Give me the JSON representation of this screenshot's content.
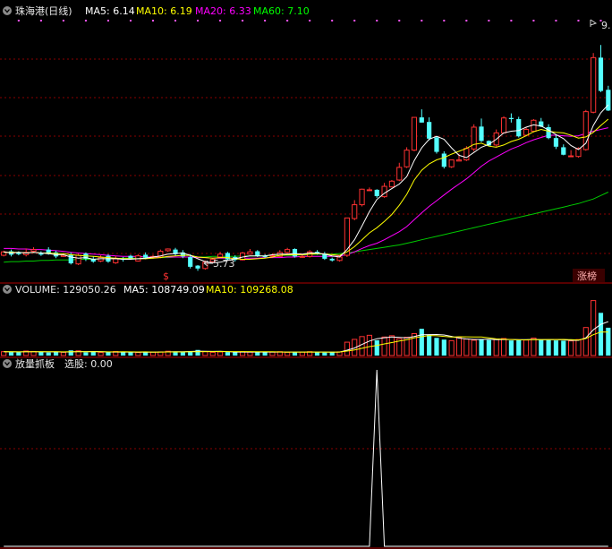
{
  "header": {
    "stock_name": "珠海港(日线)",
    "ma5": "MA5: 6.14",
    "ma10": "MA10: 6.19",
    "ma20": "MA20: 6.33",
    "ma60": "MA60: 7.10"
  },
  "volume_header": {
    "volume": "VOLUME: 129050.26",
    "ma5": "MA5: 108749.09",
    "ma10": "MA10: 109268.08"
  },
  "indicator_header": {
    "name": "放量抓板",
    "value": "选股: 0.00"
  },
  "annotations": {
    "low_label": "5.73",
    "high_label": "9.",
    "marker": "$",
    "badge": "涨榜"
  },
  "colors": {
    "up": "#ff3232",
    "down": "#54ffff",
    "ma5": "#ffffff",
    "ma10": "#ffff00",
    "ma20": "#ff00ff",
    "ma60": "#00cc00",
    "grid": "#8a0000"
  },
  "chart_data": [
    {
      "type": "candlestick",
      "series": [
        {
          "name": "K",
          "open": [
            6.0,
            6.07,
            6.04,
            6.01,
            6.07,
            6.03,
            6.1,
            6.05,
            5.98,
            6.01,
            5.85,
            6.03,
            5.93,
            5.9,
            5.99,
            5.87,
            5.94,
            5.99,
            5.9,
            6.01,
            5.96,
            5.97,
            6.08,
            6.1,
            6.05,
            5.97,
            5.82,
            5.77,
            5.89,
            5.97,
            6.04,
            5.97,
            5.92,
            6.02,
            6.07,
            5.99,
            6.0,
            5.98,
            6.05,
            6.11,
            5.98,
            5.98,
            6.06,
            6.03,
            5.94,
            5.91,
            6.0,
            6.64,
            6.88,
            7.14,
            7.14,
            7.02,
            7.19,
            7.31,
            7.54,
            7.83,
            8.4,
            8.32,
            8.05,
            7.77,
            7.54,
            7.64,
            7.66,
            7.85,
            8.24,
            7.99,
            7.92,
            8.13,
            8.39,
            8.37,
            8.09,
            8.16,
            8.33,
            8.23,
            8.04,
            7.88,
            7.72,
            7.72,
            7.84,
            8.49,
            9.44,
            8.88
          ],
          "close": [
            6.06,
            6.01,
            6.02,
            6.05,
            6.1,
            6.01,
            6.02,
            5.98,
            6.0,
            5.86,
            6.0,
            5.94,
            5.89,
            5.96,
            5.89,
            5.94,
            5.93,
            5.94,
            5.99,
            5.96,
            5.98,
            6.07,
            6.11,
            6.02,
            5.98,
            5.8,
            5.77,
            5.88,
            5.93,
            6.02,
            5.93,
            5.92,
            6.04,
            6.06,
            5.99,
            5.97,
            6.0,
            6.05,
            6.1,
            5.98,
            5.98,
            6.06,
            6.02,
            5.94,
            5.91,
            5.97,
            6.65,
            6.88,
            7.15,
            7.14,
            7.03,
            7.2,
            7.29,
            7.53,
            7.83,
            8.4,
            8.31,
            8.03,
            7.8,
            7.54,
            7.66,
            7.66,
            7.86,
            8.23,
            7.99,
            7.91,
            8.13,
            8.39,
            8.37,
            8.07,
            8.19,
            8.35,
            8.24,
            8.04,
            7.89,
            7.75,
            7.73,
            7.86,
            8.5,
            9.44,
            8.86,
            8.52
          ],
          "high": [
            6.08,
            6.1,
            6.07,
            6.12,
            6.14,
            6.07,
            6.14,
            6.08,
            6.03,
            6.05,
            6.03,
            6.05,
            5.98,
            6.0,
            6.02,
            5.99,
            5.97,
            6.01,
            6.02,
            6.05,
            6.01,
            6.1,
            6.12,
            6.13,
            6.09,
            6.02,
            5.83,
            5.91,
            5.95,
            6.06,
            6.06,
            6.0,
            6.06,
            6.11,
            6.09,
            6.02,
            6.03,
            6.09,
            6.13,
            6.12,
            6.02,
            6.09,
            6.09,
            6.06,
            5.96,
            6.0,
            6.65,
            6.96,
            7.16,
            7.18,
            7.15,
            7.26,
            7.31,
            7.61,
            7.88,
            8.4,
            8.54,
            8.4,
            8.07,
            7.81,
            7.66,
            7.77,
            7.9,
            8.28,
            8.38,
            8.0,
            8.19,
            8.42,
            8.47,
            8.41,
            8.22,
            8.37,
            8.39,
            8.28,
            8.09,
            7.93,
            7.83,
            7.88,
            8.53,
            9.52,
            9.66,
            8.95
          ],
          "low": [
            5.98,
            5.98,
            6.0,
            5.98,
            6.04,
            5.99,
            6.01,
            5.95,
            5.97,
            5.84,
            5.83,
            5.9,
            5.87,
            5.88,
            5.87,
            5.85,
            5.89,
            5.92,
            5.89,
            5.93,
            5.94,
            5.95,
            6.06,
            5.99,
            5.95,
            5.77,
            5.73,
            5.75,
            5.87,
            5.95,
            5.91,
            5.89,
            5.91,
            6.01,
            5.97,
            5.95,
            5.99,
            5.97,
            6.04,
            5.96,
            5.96,
            5.96,
            6.01,
            5.92,
            5.89,
            5.89,
            5.97,
            6.61,
            6.85,
            7.12,
            7.0,
            7.0,
            7.18,
            7.29,
            7.52,
            7.81,
            8.31,
            8.0,
            7.77,
            7.51,
            7.52,
            7.64,
            7.64,
            7.81,
            7.97,
            7.9,
            7.89,
            8.12,
            8.31,
            8.05,
            8.07,
            8.14,
            8.23,
            8.02,
            7.85,
            7.74,
            7.71,
            7.7,
            7.82,
            8.47,
            8.84,
            8.51
          ]
        },
        {
          "name": "MA5",
          "values": [
            6.06,
            6.04,
            6.05,
            6.04,
            6.05,
            6.04,
            6.03,
            6.01,
            6.01,
            5.97,
            5.95,
            5.96,
            5.93,
            5.94,
            5.94,
            5.94,
            5.93,
            5.93,
            5.94,
            5.95,
            5.97,
            5.99,
            6.02,
            6.03,
            6.04,
            6.0,
            5.94,
            5.89,
            5.87,
            5.88,
            5.91,
            5.94,
            5.97,
            5.99,
            5.99,
            5.99,
            6.01,
            6.02,
            6.02,
            6.03,
            6.02,
            6.04,
            6.04,
            6.02,
            5.99,
            5.97,
            6.1,
            6.27,
            6.51,
            6.76,
            6.97,
            7.08,
            7.16,
            7.24,
            7.37,
            7.65,
            7.87,
            8.02,
            8.07,
            8.02,
            7.87,
            7.74,
            7.7,
            7.79,
            7.88,
            7.93,
            8.02,
            8.13,
            8.16,
            8.17,
            8.23,
            8.27,
            8.25,
            8.18,
            8.1,
            8.03,
            7.91,
            7.84,
            7.95,
            8.26,
            8.48,
            8.62
          ]
        },
        {
          "name": "MA10",
          "values": [
            6.05,
            6.05,
            6.05,
            6.04,
            6.05,
            6.04,
            6.04,
            6.03,
            6.03,
            6.01,
            6.0,
            5.99,
            5.98,
            5.97,
            5.96,
            5.95,
            5.94,
            5.94,
            5.94,
            5.94,
            5.95,
            5.96,
            5.98,
            5.99,
            6.0,
            6.0,
            5.97,
            5.96,
            5.95,
            5.96,
            5.96,
            5.94,
            5.93,
            5.93,
            5.94,
            5.95,
            5.97,
            6.0,
            6.01,
            6.01,
            6.01,
            6.02,
            6.03,
            6.02,
            6.01,
            6.0,
            6.06,
            6.15,
            6.27,
            6.39,
            6.48,
            6.59,
            6.71,
            6.87,
            7.06,
            7.31,
            7.48,
            7.59,
            7.66,
            7.7,
            7.76,
            7.81,
            7.86,
            7.93,
            7.95,
            7.9,
            7.88,
            7.92,
            7.98,
            8.02,
            8.08,
            8.15,
            8.19,
            8.16,
            8.14,
            8.13,
            8.09,
            8.04,
            8.06,
            8.14,
            8.26,
            8.37
          ]
        },
        {
          "name": "MA20",
          "values": [
            6.12,
            6.12,
            6.11,
            6.11,
            6.1,
            6.1,
            6.09,
            6.08,
            6.07,
            6.05,
            6.04,
            6.03,
            6.02,
            6.01,
            6.0,
            5.99,
            5.98,
            5.98,
            5.98,
            5.97,
            5.97,
            5.97,
            5.97,
            5.97,
            5.97,
            5.97,
            5.96,
            5.96,
            5.95,
            5.95,
            5.95,
            5.95,
            5.95,
            5.95,
            5.95,
            5.96,
            5.96,
            5.96,
            5.97,
            5.97,
            5.98,
            5.98,
            5.98,
            5.98,
            5.98,
            5.99,
            6.01,
            6.06,
            6.12,
            6.17,
            6.21,
            6.27,
            6.34,
            6.41,
            6.5,
            6.62,
            6.74,
            6.85,
            6.95,
            7.05,
            7.15,
            7.24,
            7.33,
            7.44,
            7.55,
            7.64,
            7.71,
            7.78,
            7.85,
            7.9,
            7.96,
            8.01,
            8.05,
            8.09,
            8.09,
            8.08,
            8.07,
            8.08,
            8.12,
            8.16,
            8.19,
            8.22
          ]
        },
        {
          "name": "MA60",
          "values": [
            5.88,
            5.89,
            5.89,
            5.9,
            5.9,
            5.91,
            5.91,
            5.92,
            5.92,
            5.92,
            5.93,
            5.93,
            5.93,
            5.94,
            5.94,
            5.94,
            5.95,
            5.95,
            5.95,
            5.95,
            5.96,
            5.96,
            5.96,
            5.97,
            5.97,
            5.97,
            5.97,
            5.97,
            5.98,
            5.98,
            5.98,
            5.98,
            5.99,
            5.99,
            5.99,
            5.99,
            6.0,
            6.0,
            6.0,
            6.0,
            6.01,
            6.01,
            6.02,
            6.02,
            6.02,
            6.03,
            6.04,
            6.06,
            6.08,
            6.1,
            6.12,
            6.14,
            6.16,
            6.18,
            6.21,
            6.24,
            6.27,
            6.3,
            6.33,
            6.36,
            6.39,
            6.42,
            6.45,
            6.48,
            6.51,
            6.54,
            6.57,
            6.6,
            6.63,
            6.66,
            6.69,
            6.72,
            6.75,
            6.78,
            6.81,
            6.84,
            6.87,
            6.9,
            6.94,
            6.98,
            7.04,
            7.1
          ]
        }
      ],
      "ylim": [
        5.58,
        10.1
      ]
    },
    {
      "type": "bar",
      "series": [
        {
          "name": "VOLUME",
          "values": [
            18000,
            16000,
            15000,
            21000,
            19000,
            17000,
            14000,
            16000,
            15000,
            24000,
            22000,
            15000,
            17000,
            14000,
            15000,
            19000,
            16000,
            15000,
            14000,
            18000,
            16000,
            17000,
            20000,
            19000,
            16000,
            21000,
            26000,
            18000,
            15000,
            17000,
            16000,
            15000,
            18000,
            16000,
            17000,
            15000,
            16000,
            18000,
            15000,
            17000,
            16000,
            18000,
            15000,
            14000,
            16000,
            17000,
            62000,
            75000,
            88000,
            94000,
            71000,
            86000,
            92000,
            78000,
            85000,
            102000,
            124000,
            96000,
            82000,
            74000,
            69000,
            83000,
            77000,
            71000,
            74000,
            72000,
            76000,
            79000,
            70000,
            71000,
            72000,
            81000,
            74000,
            72000,
            70000,
            69000,
            68000,
            74000,
            130000,
            255000,
            198000,
            129050
          ]
        },
        {
          "name": "MA5",
          "values": [
            17500,
            17300,
            17000,
            17800,
            17800,
            17600,
            17200,
            17400,
            16200,
            17200,
            18200,
            18400,
            18600,
            18400,
            16600,
            16000,
            16200,
            16000,
            15800,
            16400,
            15800,
            16000,
            17000,
            18000,
            17600,
            18600,
            20400,
            20000,
            19200,
            19400,
            18400,
            16200,
            16200,
            16400,
            16400,
            16200,
            16400,
            16400,
            16200,
            16200,
            16400,
            16800,
            16200,
            16000,
            15800,
            16000,
            24800,
            34800,
            51600,
            67200,
            78000,
            82800,
            86200,
            84200,
            82400,
            88600,
            96200,
            97000,
            97800,
            95600,
            89000,
            80800,
            77000,
            74800,
            74800,
            75400,
            74000,
            74600,
            74200,
            73600,
            73800,
            74600,
            73600,
            73600,
            73800,
            73200,
            70600,
            70600,
            82200,
            119200,
            145000,
            157210
          ]
        },
        {
          "name": "MA10",
          "values": [
            17500,
            17400,
            17200,
            17600,
            17600,
            17600,
            17400,
            17500,
            17100,
            17500,
            17850,
            17750,
            17900,
            17500,
            16900,
            17100,
            17400,
            17200,
            16800,
            16900,
            16200,
            16000,
            16600,
            17200,
            16800,
            17300,
            18000,
            18400,
            18100,
            18500,
            18200,
            18400,
            18200,
            18300,
            17800,
            17400,
            17300,
            16800,
            16300,
            16400,
            16300,
            16600,
            16300,
            16200,
            16100,
            16100,
            20600,
            25650,
            33800,
            41500,
            47000,
            54100,
            60300,
            67300,
            73100,
            81900,
            87800,
            93050,
            91800,
            89050,
            85600,
            87150,
            87000,
            85900,
            86250,
            82200,
            77400,
            75800,
            74400,
            73000,
            72750,
            74500,
            73800,
            74300,
            74300,
            74800,
            73600,
            72100,
            79000,
            96900,
            109300,
            108749
          ]
        }
      ],
      "ylim": [
        0,
        270000
      ]
    },
    {
      "type": "line",
      "series": [
        {
          "name": "选股",
          "values": [
            0,
            0,
            0,
            0,
            0,
            0,
            0,
            0,
            0,
            0,
            0,
            0,
            0,
            0,
            0,
            0,
            0,
            0,
            0,
            0,
            0,
            0,
            0,
            0,
            0,
            0,
            0,
            0,
            0,
            0,
            0,
            0,
            0,
            0,
            0,
            0,
            0,
            0,
            0,
            0,
            0,
            0,
            0,
            0,
            0,
            0,
            0,
            0,
            0,
            0,
            1,
            0,
            0,
            0,
            0,
            0,
            0,
            0,
            0,
            0,
            0,
            0,
            0,
            0,
            0,
            0,
            0,
            0,
            0,
            0,
            0,
            0,
            0,
            0,
            0,
            0,
            0,
            0,
            0,
            0,
            0,
            0
          ]
        }
      ],
      "ylim": [
        0,
        1
      ]
    }
  ]
}
